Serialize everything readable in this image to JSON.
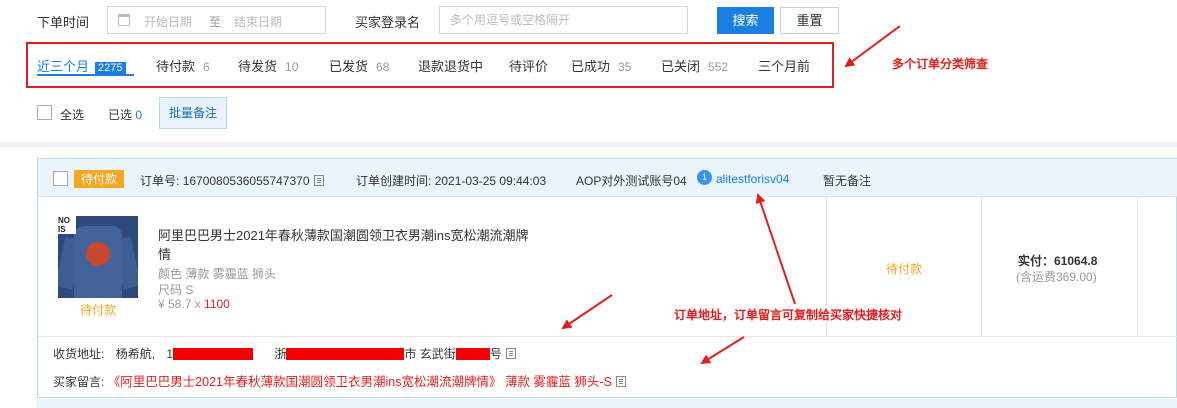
{
  "filters": {
    "order_time_label": "下单时间",
    "start_date_placeholder": "开始日期",
    "date_sep": "至",
    "end_date_placeholder": "结束日期",
    "buyer_label": "买家登录名",
    "buyer_placeholder": "多个用逗号或空格隔开",
    "search_button": "搜索",
    "reset_button": "重置"
  },
  "tabs": [
    {
      "label": "近三个月",
      "count": "2275"
    },
    {
      "label": "待付款",
      "count": "6"
    },
    {
      "label": "待发货",
      "count": "10"
    },
    {
      "label": "已发货",
      "count": "68"
    },
    {
      "label": "退款退货中",
      "count": ""
    },
    {
      "label": "待评价",
      "count": ""
    },
    {
      "label": "已成功",
      "count": "35"
    },
    {
      "label": "已关闭",
      "count": "552"
    },
    {
      "label": "三个月前",
      "count": ""
    }
  ],
  "annotations": {
    "tabs_note": "多个订单分类筛查",
    "copy_note": "订单地址，订单留言可复制给买家快捷核对"
  },
  "selection": {
    "select_all": "全选",
    "selected_label": "已选",
    "selected_count": "0",
    "batch_remark_button": "批量备注"
  },
  "order": {
    "status_badge": "待付款",
    "order_no_label": "订单号:",
    "order_no": "1670080536055747370",
    "created_label": "订单创建时间:",
    "created_time": "2021-03-25 09:44:03",
    "account": "AOP对外测试账号04",
    "wangwang_name": "alitestforisv04",
    "remark_status": "暂无备注",
    "product": {
      "title": "阿里巴巴男士2021年春秋薄款国潮圆领卫衣男潮ins宽松潮流潮牌情",
      "color": "颜色 薄款 雾霾蓝 狮头",
      "size": "尺码 S",
      "unit_price": "¥ 58.7 x",
      "quantity": "1100",
      "status_under_image": "待付款"
    },
    "status_text": "待付款",
    "paid_label": "实付：61064.8",
    "shipping_label": "(含运费369.00)",
    "address_label": "收货地址:",
    "address_name": "杨希航,",
    "address_tail": "市 玄武街",
    "address_tail2": "号",
    "remark_label": "买家留言:",
    "remark_value": "《阿里巴巴男士2021年春秋薄款国潮圆领卫衣男潮ins宽松潮流潮牌情》 薄款 雾霾蓝 狮头-S"
  },
  "colors": {
    "primary": "#1a7fe3",
    "annotation_red": "#e02020",
    "pending_orange": "#f5a623",
    "card_header_bg": "#e9f4fb"
  }
}
